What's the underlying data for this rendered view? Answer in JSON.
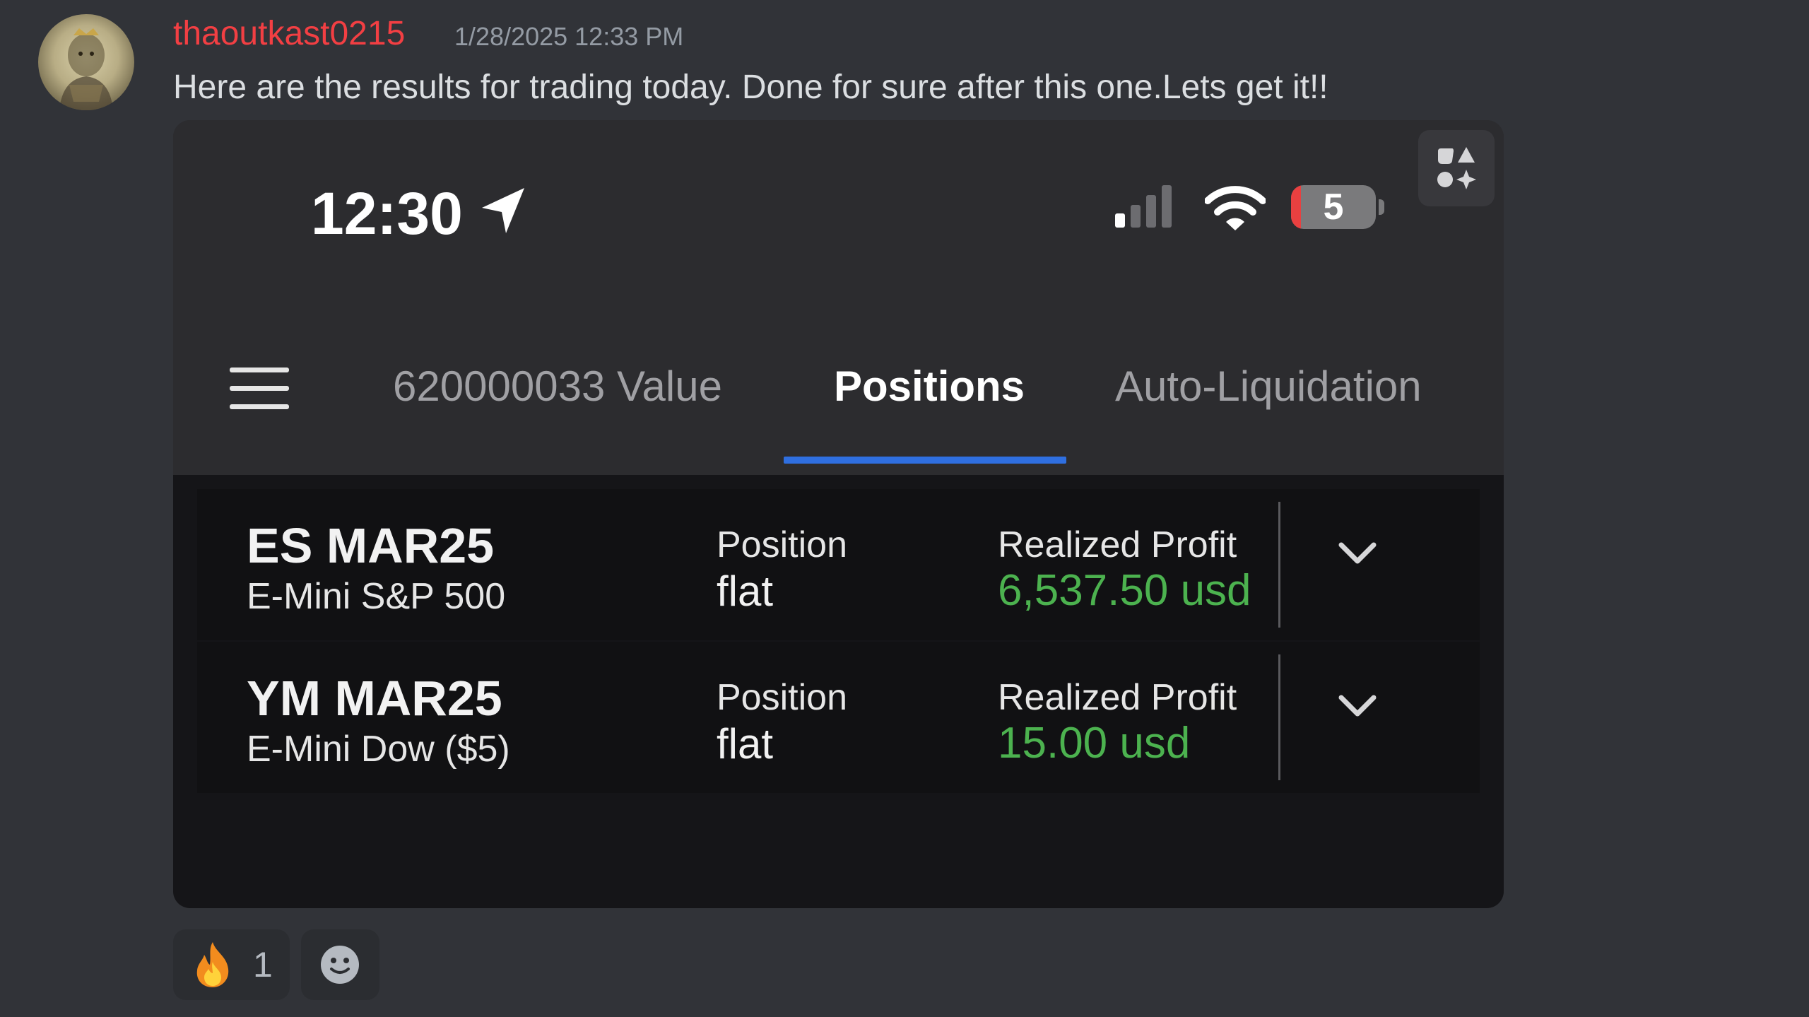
{
  "message": {
    "username": "thaoutkast0215",
    "timestamp": "1/28/2025 12:33 PM",
    "text": "Here are the results for trading today. Done for sure after this one.Lets get it!!"
  },
  "phone": {
    "status_bar": {
      "time": "12:30",
      "battery_level": "5",
      "battery_fraction": 0.12
    },
    "nav": {
      "tabs": [
        {
          "label": "620000033 Value",
          "active": false
        },
        {
          "label": "Positions",
          "active": true
        },
        {
          "label": "Auto-Liquidation",
          "active": false
        }
      ]
    },
    "positions": [
      {
        "symbol": "ES MAR25",
        "contract": "E-Mini S&P 500",
        "position_label": "Position",
        "position_value": "flat",
        "profit_label": "Realized Profit",
        "profit_value": "6,537.50 usd"
      },
      {
        "symbol": "YM MAR25",
        "contract": "E-Mini Dow ($5)",
        "position_label": "Position",
        "position_value": "flat",
        "profit_label": "Realized Profit",
        "profit_value": "15.00 usd"
      }
    ]
  },
  "reactions": [
    {
      "emoji_name": "fire-emoji",
      "count": "1"
    },
    {
      "emoji_name": "add-reaction-icon"
    }
  ],
  "colors": {
    "username": "#f23f43",
    "profit": "#4cb24f",
    "tab_underline": "#2f6fe0",
    "background": "#313338"
  }
}
